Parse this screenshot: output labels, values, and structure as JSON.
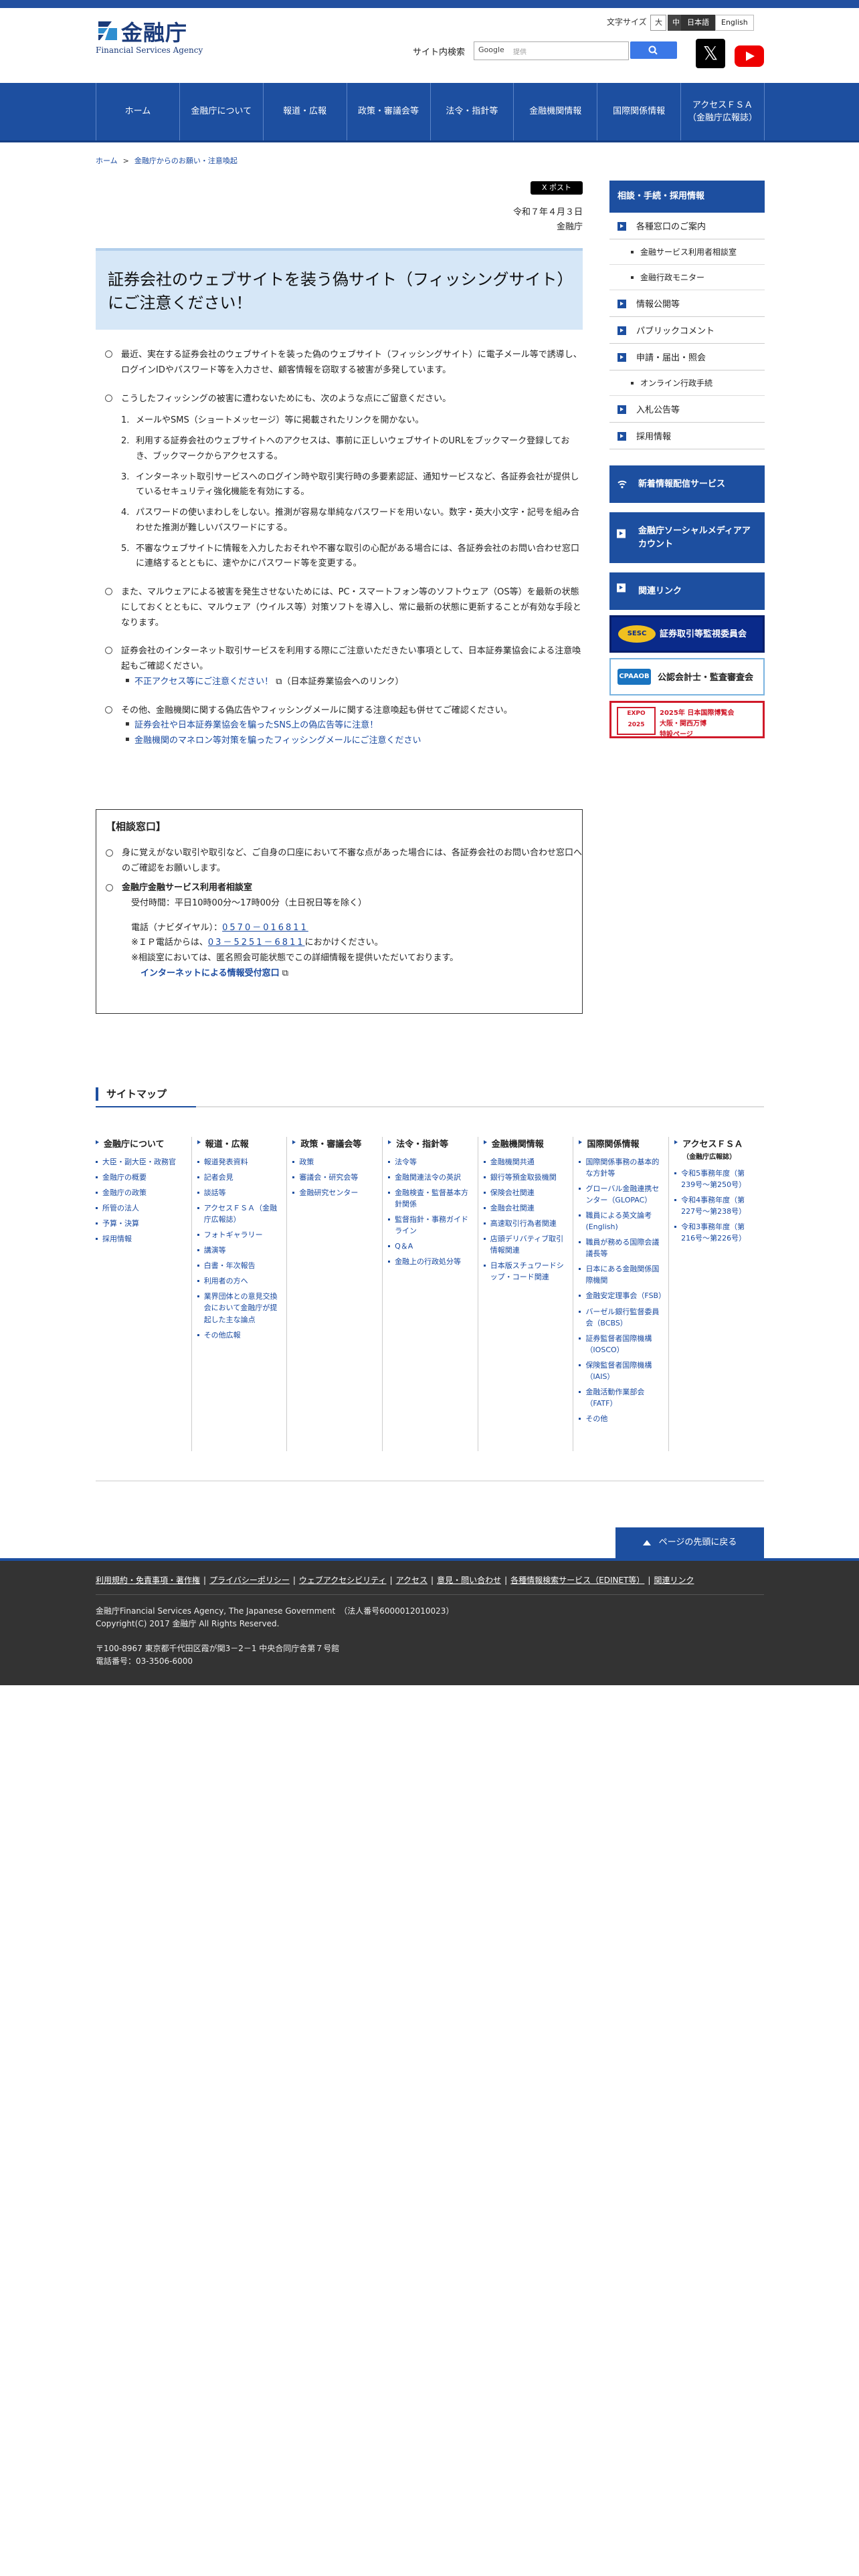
{
  "header": {
    "logo_title": "金融庁",
    "logo_sub": "Financial Services Agency",
    "font_size_label": "文字サイズ",
    "font_sizes": [
      "大",
      "中",
      "小"
    ],
    "languages": [
      "日本語",
      "English"
    ],
    "search_label": "サイト内検索",
    "search_engine": "Google",
    "search_placeholder": "提供",
    "sns_x": "𝕏"
  },
  "nav": [
    "ホーム",
    "金融庁について",
    "報道・広報",
    "政策・審議会等",
    "法令・指針等",
    "金融機関情報",
    "国際関係情報",
    "アクセスＦＳＡ\n（金融庁広報誌）"
  ],
  "breadcrumb": [
    "ホーム",
    "金融庁からのお願い・注意喚起"
  ],
  "tweet_label": "X ポスト",
  "date": "令和７年４月３日",
  "issuer": "金融庁",
  "title": "証券会社のウェブサイトを装う偽サイト（フィッシングサイト）にご注意ください！",
  "body": {
    "p1": "最近、実在する証券会社のウェブサイトを装った偽のウェブサイト（フィッシングサイト）に電子メール等で誘導し、ログインIDやパスワード等を入力させ、顧客情報を窃取する被害が多発しています。",
    "p2_intro": "こうしたフィッシングの被害に遭わないためにも、次のような点にご留意ください。",
    "p2_list": [
      "メールやSMS（ショートメッセージ）等に掲載されたリンクを開かない。",
      "利用する証券会社のウェブサイトへのアクセスは、事前に正しいウェブサイトのURLをブックマーク登録しておき、ブックマークからアクセスする。",
      "インターネット取引サービスへのログイン時や取引実行時の多要素認証、通知サービスなど、各証券会社が提供しているセキュリティ強化機能を有効にする。",
      "パスワードの使いまわしをしない。推測が容易な単純なパスワードを用いない。数字・英大小文字・記号を組み合わせた推測が難しいパスワードにする。",
      "不審なウェブサイトに情報を入力したおそれや不審な取引の心配がある場合には、各証券会社のお問い合わせ窓口に連絡するとともに、速やかにパスワード等を変更する。"
    ],
    "p3": "また、マルウェアによる被害を発生させないためには、PC・スマートフォン等のソフトウェア（OS等）を最新の状態にしておくとともに、マルウェア（ウイルス等）対策ソフトを導入し、常に最新の状態に更新することが有効な手段となります。",
    "p4": "証券会社のインターネット取引サービスを利用する際にご注意いただきたい事項として、日本証券業協会による注意喚起もご確認ください。",
    "p4_link": "不正アクセス等にご注意ください！",
    "p4_link_note": "（日本証券業協会へのリンク）",
    "p5": "その他、金融機関に関する偽広告やフィッシングメールに関する注意喚起も併せてご確認ください。",
    "p5_links": [
      "証券会社や日本証券業協会を騙ったSNS上の偽広告等に注意！",
      "金融機関のマネロン等対策を騙ったフィッシングメールにご注意ください"
    ]
  },
  "contact": {
    "head": "【相談窓口】",
    "p1": "身に覚えがない取引や取引など、ご自身の口座において不審な点があった場合には、各証券会社のお問い合わせ窓口へのご確認をお願いします。",
    "p2_title": "金融庁金融サービス利用者相談室",
    "hours": "受付時間：平日10時00分～17時00分（土日祝日等を除く）",
    "tel_label": "電話（ナビダイヤル）：",
    "tel": "0570－016811",
    "ip_label": "※ＩＰ電話からは、",
    "ip_tel": "03－5251－6811",
    "ip_suffix": "におかけください。",
    "note": "※相談室においては、匿名照会可能状態でこの詳細情報を提供いただいております。",
    "web_link": "インターネットによる情報受付窓口"
  },
  "sidebar": {
    "head": "相談・手続・採用情報",
    "items": [
      {
        "label": "各種窓口のご案内",
        "sub": [
          "金融サービス利用者相談室",
          "金融行政モニター"
        ]
      },
      {
        "label": "情報公開等",
        "sub": []
      },
      {
        "label": "パブリックコメント",
        "sub": []
      },
      {
        "label": "申請・届出・照会",
        "sub": [
          "オンライン行政手続"
        ]
      },
      {
        "label": "入札公告等",
        "sub": []
      },
      {
        "label": "採用情報",
        "sub": []
      }
    ],
    "banners": [
      "新着情報配信サービス",
      "金融庁ソーシャルメディアアカウント",
      "関連リンク"
    ],
    "sec_label": "証券取引等監視委員会",
    "sec_logo": "SESC",
    "cpa_label": "公認会計士・監査審査会",
    "cpa_logo": "CPAAOB",
    "expo_logo": "EXPO 2025",
    "expo_text": "2025年 日本国際博覧会\n大阪・関西万博\n特設ページ"
  },
  "sitemap": {
    "title": "サイトマップ",
    "columns": [
      {
        "head": "金融庁について",
        "sub": "",
        "items": [
          "大臣・副大臣・政務官",
          "金融庁の概要",
          "金融庁の政策",
          "所管の法人",
          "予算・決算",
          "採用情報"
        ]
      },
      {
        "head": "報道・広報",
        "sub": "",
        "items": [
          "報道発表資料",
          "記者会見",
          "談話等",
          "アクセスＦＳＡ（金融庁広報誌）",
          "フォトギャラリー",
          "講演等",
          "白書・年次報告",
          "利用者の方へ",
          "業界団体との意見交換会において金融庁が提起した主な論点",
          "その他広報"
        ]
      },
      {
        "head": "政策・審議会等",
        "sub": "",
        "items": [
          "政策",
          "審議会・研究会等",
          "金融研究センター"
        ]
      },
      {
        "head": "法令・指針等",
        "sub": "",
        "items": [
          "法令等",
          "金融関連法令の英訳",
          "金融検査・監督基本方針関係",
          "監督指針・事務ガイドライン",
          "Q＆A",
          "金融上の行政処分等"
        ]
      },
      {
        "head": "金融機関情報",
        "sub": "",
        "items": [
          "金融機関共通",
          "銀行等預金取扱機関",
          "保険会社関連",
          "金融会社関連",
          "高速取引行為者関連",
          "店頭デリバティブ取引情報関連",
          "日本版スチュワードシップ・コード関連"
        ]
      },
      {
        "head": "国際関係情報",
        "sub": "",
        "items": [
          "国際関係事務の基本的な方針等",
          "グローバル金融連携センター（GLOPAC）",
          "職員による英文論考(English)",
          "職員が務める国際会議議長等",
          "日本にある金融関係国際機関",
          "金融安定理事会（FSB）",
          "バーゼル銀行監督委員会（BCBS）",
          "証券監督者国際機構（IOSCO）",
          "保険監督者国際機構（IAIS）",
          "金融活動作業部会（FATF）",
          "その他"
        ]
      },
      {
        "head": "アクセスＦＳＡ",
        "sub": "（金融庁広報誌）",
        "items": [
          "令和5事務年度（第239号～第250号）",
          "令和4事務年度（第227号～第238号）",
          "令和3事務年度（第216号～第226号）"
        ]
      }
    ]
  },
  "pagetop": "ページの先頭に戻る",
  "footer": {
    "links": [
      "利用規約・免責事項・著作権",
      "プライバシーポリシー",
      "ウェブアクセシビリティ",
      "アクセス",
      "意見・問い合わせ",
      "各種情報検索サービス（EDINET等）",
      "関連リンク"
    ],
    "copy1": "金融庁Financial Services Agency, The Japanese Government　（法人番号6000012010023）",
    "copy2": "Copyright(C) 2017 金融庁 All Rights Reserved.",
    "addr": "〒100-8967 東京都千代田区霞が関3－2－1 中央合同庁舎第７号館",
    "tel": "電話番号：03-3506-6000"
  },
  "colors": {
    "brand": "#1d4fa0",
    "title_bg": "#d6e7f7",
    "footer_bg": "#333333"
  }
}
